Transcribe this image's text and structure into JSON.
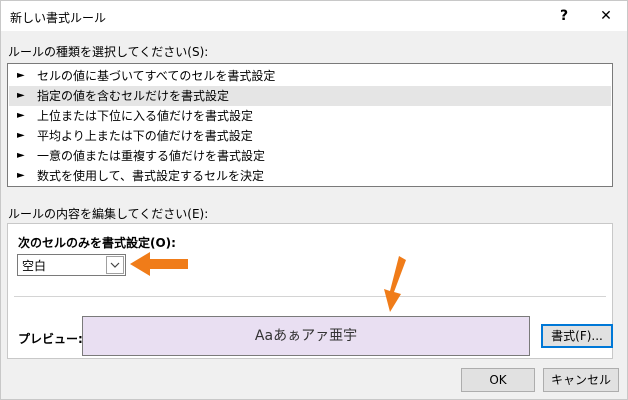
{
  "title": "新しい書式ルール",
  "titlebar": {
    "help": "?",
    "close": "✕"
  },
  "rule_type_label": "ルールの種類を選択してください(S):",
  "rule_types": [
    "セルの値に基づいてすべてのセルを書式設定",
    "指定の値を含むセルだけを書式設定",
    "上位または下位に入る値だけを書式設定",
    "平均より上または下の値だけを書式設定",
    "一意の値または重複する値だけを書式設定",
    "数式を使用して、書式設定するセルを決定"
  ],
  "rule_arrow": "►",
  "selected_index": 1,
  "edit_label": "ルールの内容を編集してください(E):",
  "condition_label": "次のセルのみを書式設定(O):",
  "condition_value": "空白",
  "preview_label": "プレビュー:",
  "preview_text": "Aaあぁアァ亜宇",
  "buttons": {
    "format": "書式(F)...",
    "ok": "OK",
    "cancel": "キャンセル"
  },
  "colors": {
    "accent": "#0078d7",
    "annotation": "#f07c19",
    "preview_bg": "#e9dff2",
    "selected_row": "#e5e5e5"
  }
}
